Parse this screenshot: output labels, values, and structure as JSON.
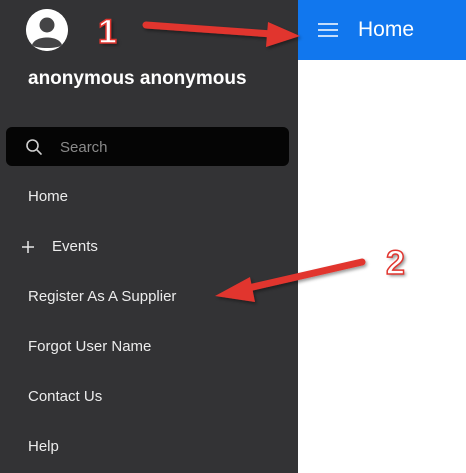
{
  "sidebar": {
    "user_name": "anonymous anonymous",
    "search": {
      "placeholder": "Search"
    },
    "items": [
      {
        "label": "Home"
      },
      {
        "label": "Events",
        "expand_icon": "plus-icon"
      },
      {
        "label": "Register As A Supplier"
      },
      {
        "label": "Forgot User Name"
      },
      {
        "label": "Contact Us"
      },
      {
        "label": "Help"
      }
    ]
  },
  "header": {
    "menu_icon": "hamburger-menu-icon",
    "title": "Home"
  },
  "annotations": [
    {
      "number": "1"
    },
    {
      "number": "2"
    }
  ],
  "colors": {
    "sidebar_bg": "#333335",
    "search_bg": "#050505",
    "header_bg": "#1177ee",
    "annotation_red": "#e1352f"
  }
}
